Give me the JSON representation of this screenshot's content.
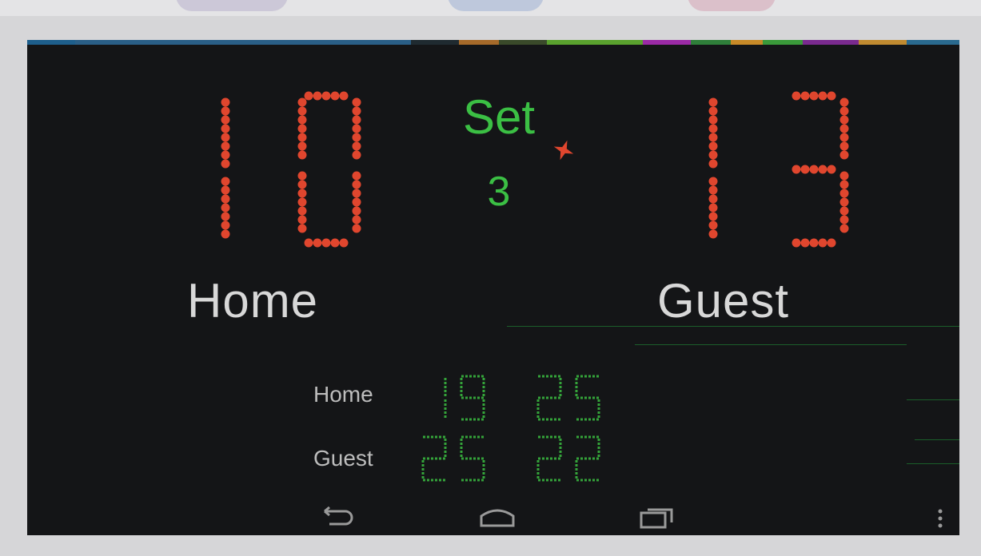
{
  "colors": {
    "screen_bg": "#141517",
    "score_red": "#e0462e",
    "set_green": "#3bbf44",
    "segment_green": "#34a43a",
    "team_text": "#d8d8d8"
  },
  "scoreboard": {
    "home_score": "10",
    "guest_score": "13",
    "set_label": "Set",
    "set_number": "3",
    "serving_side": "home",
    "home_name": "Home",
    "guest_name": "Guest"
  },
  "set_history": {
    "rows": [
      {
        "team": "Home",
        "scores": [
          "19",
          "25"
        ]
      },
      {
        "team": "Guest",
        "scores": [
          "25",
          "22"
        ]
      }
    ]
  },
  "navbar": {
    "buttons": [
      {
        "name": "back-icon"
      },
      {
        "name": "home-icon"
      },
      {
        "name": "recent-apps-icon"
      },
      {
        "name": "overflow-menu-icon"
      }
    ]
  }
}
